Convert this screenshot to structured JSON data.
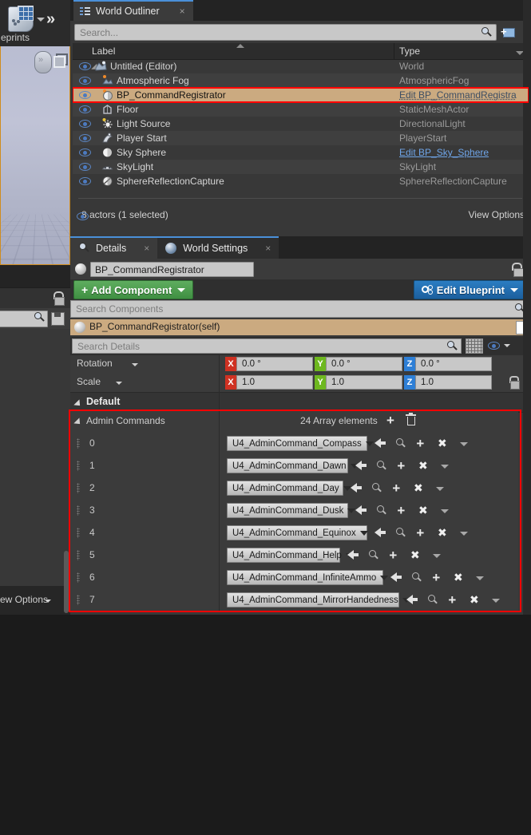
{
  "left": {
    "blueprints_label": "eprints",
    "blueprints_icon": "blueprint-icon",
    "view_options_label": "ew Options"
  },
  "outliner": {
    "tab_label": "World Outliner",
    "tab_close": "×",
    "search_placeholder": "Search...",
    "new_folder_icon": "new-folder-icon",
    "columns": {
      "label": "Label",
      "type": "Type"
    },
    "rows": [
      {
        "label": "Untitled (Editor)",
        "type": "World",
        "indent": 40,
        "icon": "world-icon",
        "link": "none",
        "selected": false,
        "expander": true
      },
      {
        "label": "Atmospheric Fog",
        "type": "AtmosphericFog",
        "indent": 48,
        "icon": "fog-icon",
        "link": "none",
        "selected": false,
        "expander": false
      },
      {
        "label": "BP_CommandRegistrator",
        "type": "Edit BP_CommandRegistra",
        "indent": 48,
        "icon": "blueprint-actor-icon",
        "link": "dark",
        "selected": true,
        "expander": false
      },
      {
        "label": "Floor",
        "type": "StaticMeshActor",
        "indent": 48,
        "icon": "staticmesh-icon",
        "link": "none",
        "selected": false,
        "expander": false
      },
      {
        "label": "Light Source",
        "type": "DirectionalLight",
        "indent": 48,
        "icon": "dirlight-icon",
        "link": "none",
        "selected": false,
        "expander": false
      },
      {
        "label": "Player Start",
        "type": "PlayerStart",
        "indent": 48,
        "icon": "playerstart-icon",
        "link": "none",
        "selected": false,
        "expander": false
      },
      {
        "label": "Sky Sphere",
        "type": "Edit BP_Sky_Sphere",
        "indent": 48,
        "icon": "sphere-icon",
        "link": "blue",
        "selected": false,
        "expander": false
      },
      {
        "label": "SkyLight",
        "type": "SkyLight",
        "indent": 48,
        "icon": "skylight-icon",
        "link": "none",
        "selected": false,
        "expander": false
      },
      {
        "label": "SphereReflectionCapture",
        "type": "SphereReflectionCapture",
        "indent": 48,
        "icon": "reflection-icon",
        "link": "none",
        "selected": false,
        "expander": false
      }
    ],
    "footer_count": "8 actors (1 selected)",
    "view_options_label": "View Options"
  },
  "details": {
    "tabs": [
      {
        "label": "Details",
        "icon": "details-magnifier-icon",
        "active": true
      },
      {
        "label": "World Settings",
        "icon": "globe-icon",
        "active": false
      }
    ],
    "tab_close": "×",
    "actor_name": "BP_CommandRegistrator",
    "add_component_label": "Add Component",
    "add_component_plus": "+",
    "edit_blueprint_label": "Edit Blueprint",
    "search_components_placeholder": "Search Components",
    "component_self_label": "BP_CommandRegistrator(self)",
    "search_details_placeholder": "Search Details",
    "transform_rows": [
      {
        "label": "Rotation",
        "x": "0.0 °",
        "y": "0.0 °",
        "z": "0.0 °",
        "lock": false
      },
      {
        "label": "Scale",
        "x": "1.0",
        "y": "1.0",
        "z": "1.0",
        "lock": true
      }
    ],
    "default_section_label": "Default",
    "array": {
      "property_label": "Admin Commands",
      "element_count_label": "24 Array elements",
      "add_icon": "plus-icon",
      "delete_icon": "trash-icon",
      "elements": [
        {
          "index": "0",
          "value": "U4_AdminCommand_Compass"
        },
        {
          "index": "1",
          "value": "U4_AdminCommand_Dawn"
        },
        {
          "index": "2",
          "value": "U4_AdminCommand_Day"
        },
        {
          "index": "3",
          "value": "U4_AdminCommand_Dusk"
        },
        {
          "index": "4",
          "value": "U4_AdminCommand_Equinox"
        },
        {
          "index": "5",
          "value": "U4_AdminCommand_Help"
        },
        {
          "index": "6",
          "value": "U4_AdminCommand_InfiniteAmmo"
        },
        {
          "index": "7",
          "value": "U4_AdminCommand_MirrorHandedness"
        }
      ],
      "row_actions": [
        "back-arrow-icon",
        "browse-icon",
        "plus-icon",
        "clear-icon",
        "chevron-down-icon"
      ]
    }
  },
  "colors": {
    "selection_highlight": "#cbaa80",
    "annotation_red": "#ff0000",
    "accent_blue": "#4a90d9",
    "add_green": "#3f8f42",
    "edit_blue": "#1c5f9e",
    "axis_x": "#cf3122",
    "axis_y": "#6eb81f",
    "axis_z": "#2e7fd6"
  }
}
